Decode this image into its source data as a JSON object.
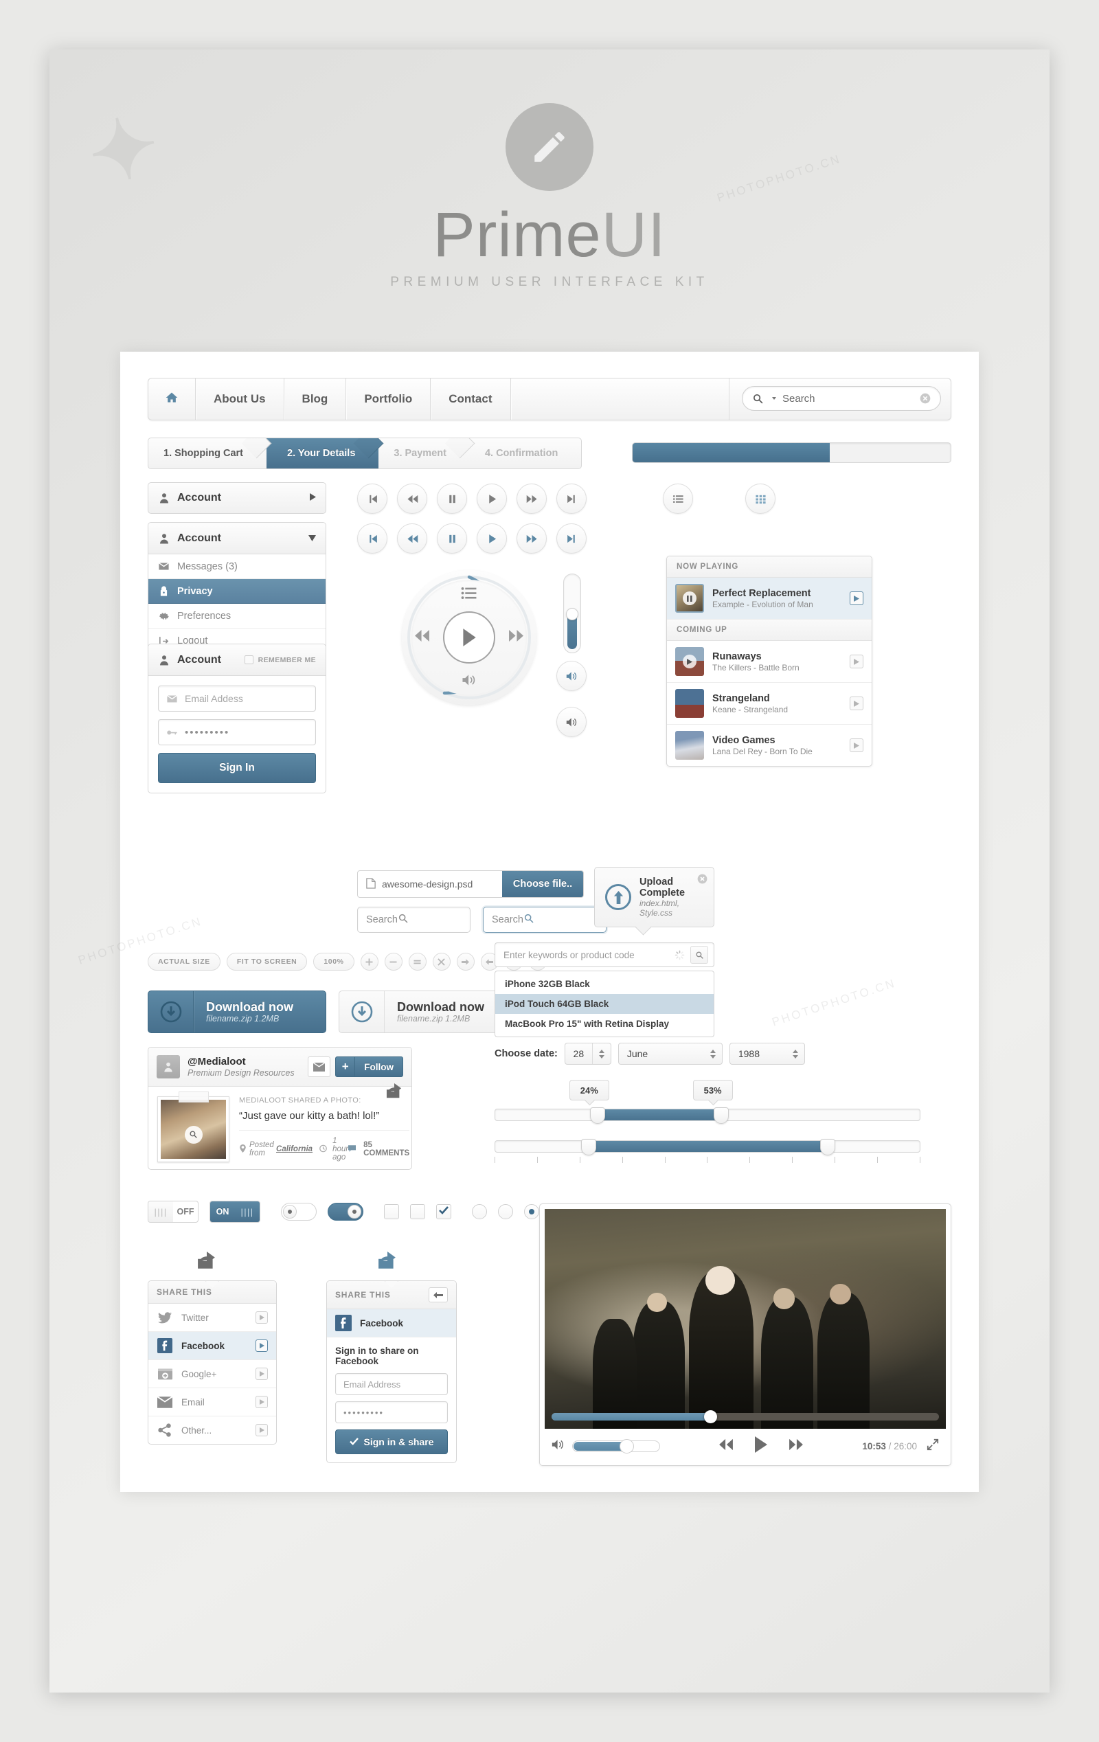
{
  "hero": {
    "title_light": "Prime",
    "title_bold": "UI",
    "subtitle": "PREMIUM USER INTERFACE KIT",
    "icon": "pencil-icon"
  },
  "navbar": {
    "home_icon": "home-icon",
    "items": [
      "About Us",
      "Blog",
      "Portfolio",
      "Contact"
    ],
    "search": {
      "placeholder": "Search",
      "icon": "search-icon",
      "clear_icon": "clear-circle-icon",
      "dropdown_icon": "caret-down-icon"
    }
  },
  "breadcrumb": {
    "steps": [
      {
        "label": "1. Shopping Cart",
        "state": "done"
      },
      {
        "label": "2. Your Details",
        "state": "active"
      },
      {
        "label": "3. Payment",
        "state": "pending"
      },
      {
        "label": "4. Confirmation",
        "state": "pending"
      }
    ]
  },
  "progress": {
    "percent": 62,
    "fill_color": "#4e7b97"
  },
  "accordion_collapsed": {
    "label": "Account",
    "icon": "user-icon",
    "arrow": "caret-right-icon"
  },
  "accordion_expanded": {
    "label": "Account",
    "icon": "user-icon",
    "arrow": "caret-down-icon",
    "rows": [
      {
        "label": "Messages (3)",
        "icon": "envelope-icon",
        "selected": false
      },
      {
        "label": "Privacy",
        "icon": "lock-icon",
        "selected": true
      },
      {
        "label": "Preferences",
        "icon": "gear-icon",
        "selected": false
      },
      {
        "label": "Logout",
        "icon": "logout-icon",
        "selected": false
      }
    ]
  },
  "login": {
    "title": "Account",
    "title_icon": "user-icon",
    "remember_label": "REMEMBER ME",
    "remember_checked": false,
    "email_placeholder": "Email Addess",
    "email_icon": "envelope-icon",
    "password_value": "•••••••••",
    "password_icon": "key-icon",
    "submit_label": "Sign In"
  },
  "media_buttons": {
    "row_grey": [
      "prev-track-icon",
      "rewind-icon",
      "pause-icon",
      "play-icon",
      "fast-forward-icon",
      "next-track-icon"
    ],
    "row_blue": [
      "prev-track-icon",
      "rewind-icon",
      "pause-icon",
      "play-icon",
      "fast-forward-icon",
      "next-track-icon"
    ]
  },
  "dial": {
    "center_icon": "play-icon",
    "top_icon": "playlist-icon",
    "bottom_icon": "volume-icon",
    "left_icon": "rewind-icon",
    "right_icon": "fast-forward-icon",
    "progress_percent": 62,
    "ring_color": "#5c88a4"
  },
  "volume_slider": {
    "level_percent": 52
  },
  "volume_buttons": [
    "volume-icon",
    "volume-icon"
  ],
  "view_toggles": [
    {
      "icon": "list-view-icon",
      "active": false
    },
    {
      "icon": "grid-view-icon",
      "active": true
    }
  ],
  "playlist": {
    "now_playing_header": "NOW PLAYING",
    "coming_up_header": "COMING UP",
    "now_playing": {
      "title": "Perfect Replacement",
      "subtitle": "Example - Evolution of Man",
      "button_icon": "play-small-icon",
      "art_colors": [
        "#c8b48a",
        "#6a5b44"
      ]
    },
    "queue": [
      {
        "title": "Runaways",
        "subtitle": "The Killers - Battle Born",
        "button_icon": "play-small-icon",
        "art_colors": [
          "#8aa3b8",
          "#7d4238"
        ]
      },
      {
        "title": "Strangeland",
        "subtitle": "Keane - Strangeland",
        "button_icon": "play-small-icon",
        "art_colors": [
          "#5d7fa4",
          "#7b3a33"
        ]
      },
      {
        "title": "Video Games",
        "subtitle": "Lana Del Rey - Born To Die",
        "button_icon": "play-small-icon",
        "art_colors": [
          "#8fa8c4",
          "#cfd7e2"
        ]
      }
    ]
  },
  "file_input": {
    "filename": "awesome-design.psd",
    "button_label": "Choose file..",
    "icon": "document-icon"
  },
  "search_small": {
    "placeholder": "Search",
    "icon": "search-icon"
  },
  "search_small_focus": {
    "placeholder": "Search",
    "icon": "search-icon"
  },
  "upload_toast": {
    "title": "Upload Complete",
    "files": "index.html, Style.css",
    "icon": "upload-arrow-icon",
    "close_icon": "close-circle-icon"
  },
  "zoom_toolbar": {
    "pills": [
      "ACTUAL SIZE",
      "FIT TO SCREEN",
      "100%"
    ],
    "icons": [
      "plus-icon",
      "minus-icon",
      "equals-icon",
      "close-icon",
      "arrow-right-icon",
      "arrow-left-icon",
      "arrow-up-icon",
      "arrow-down-icon"
    ]
  },
  "downloads": [
    {
      "title": "Download now",
      "meta": "filename.zip 1.2MB",
      "icon": "download-circle-icon",
      "style": "primary"
    },
    {
      "title": "Download now",
      "meta": "filename.zip 1.2MB",
      "icon": "download-circle-icon",
      "style": "ghost"
    }
  ],
  "autocomplete": {
    "placeholder": "Enter keywords or product code",
    "spinner_icon": "spinner-icon",
    "search_icon": "search-icon",
    "options": [
      {
        "label": "iPhone 32GB Black",
        "highlighted": false
      },
      {
        "label": "iPod Touch 64GB Black",
        "highlighted": true
      },
      {
        "label": "MacBook Pro 15\" with Retina Display",
        "highlighted": false
      }
    ]
  },
  "social": {
    "handle": "@Medialoot",
    "tagline": "Premium Design Resources",
    "mail_icon": "envelope-icon",
    "follow_label": "Follow",
    "follow_plus": "+",
    "post_kicker": "MEDIALOOT SHARED A PHOTO:",
    "post_quote": "“Just gave our kitty a bath! lol!”",
    "location_label": "Posted from",
    "location": "California",
    "time_ago": "1 hour ago",
    "comments": "85 COMMENTS",
    "share_icon": "share-arrow-icon",
    "avatar_icon": "user-icon",
    "photo_zoom_icon": "magnify-icon"
  },
  "date_picker": {
    "label": "Choose date:",
    "day": "28",
    "month": "June",
    "year": "1988"
  },
  "range_slider_1": {
    "low_label": "24%",
    "high_label": "53%",
    "low_percent": 24,
    "high_percent": 53
  },
  "range_slider_2": {
    "low_percent": 22,
    "high_percent": 78,
    "tick_count": 11
  },
  "toggles": {
    "switch_off_label": "OFF",
    "switch_on_label": "ON",
    "pill_off": false,
    "pill_on": true,
    "checkboxes": [
      false,
      false,
      true
    ],
    "radios": [
      false,
      false,
      true
    ],
    "check_icon": "checkmark-icon"
  },
  "share_panel_list": {
    "header": "SHARE THIS",
    "trigger_icon": "share-arrow-icon",
    "items": [
      {
        "label": "Twitter",
        "icon": "twitter-icon",
        "selected": false
      },
      {
        "label": "Facebook",
        "icon": "facebook-icon",
        "selected": true
      },
      {
        "label": "Google+",
        "icon": "googleplus-icon",
        "selected": false
      },
      {
        "label": "Email",
        "icon": "envelope-icon",
        "selected": false
      },
      {
        "label": "Other...",
        "icon": "share-nodes-icon",
        "selected": false
      }
    ]
  },
  "share_panel_form": {
    "header": "SHARE THIS",
    "trigger_icon": "share-arrow-icon",
    "back_icon": "arrow-left-icon",
    "service": "Facebook",
    "service_icon": "facebook-icon",
    "prompt": "Sign in to share on Facebook",
    "email_placeholder": "Email Address",
    "password_value": "•••••••••",
    "submit_label": "Sign in & share",
    "submit_icon": "checkmark-icon"
  },
  "video_player": {
    "progress_percent": 41,
    "volume_percent": 62,
    "current_time": "10:53",
    "total_time": "26:00",
    "time_separator": "/",
    "volume_icon": "volume-icon",
    "rewind_icon": "rewind-icon",
    "play_icon": "play-icon",
    "forward_icon": "fast-forward-icon",
    "fullscreen_icon": "fullscreen-icon"
  },
  "watermarks": {
    "text": "PHOTOPHOTO.CN"
  }
}
